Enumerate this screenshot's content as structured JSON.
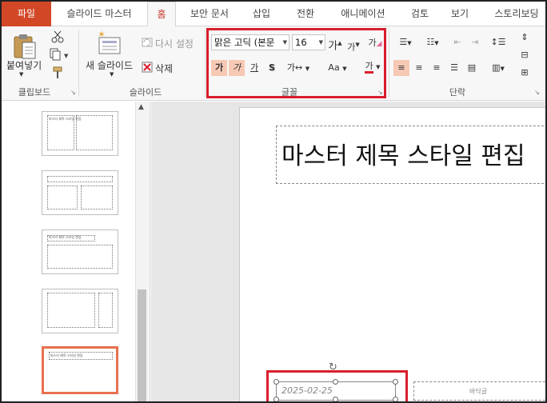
{
  "tabs": [
    "파일",
    "슬라이드 마스터",
    "홈",
    "보안 문서",
    "삽입",
    "전환",
    "애니메이션",
    "검토",
    "보기",
    "스토리보딩"
  ],
  "clipboard": {
    "paste_label": "붙여넣기",
    "group_label": "클립보드"
  },
  "slides_group": {
    "new_slide_label": "새 슬라이드",
    "reset_label": "다시 설정",
    "delete_label": "삭제",
    "group_label": "슬라이드"
  },
  "font_group": {
    "font_name": "맑은 고딕 (본문",
    "font_size": "16",
    "grow_label": "가",
    "shrink_label": "가",
    "clear_label": "가",
    "bold_label": "가",
    "italic_label": "가",
    "underline_label": "가",
    "shadow_label": "S",
    "spacing_label": "가↔",
    "case_label": "Aa",
    "color_label": "가",
    "group_label": "글꼴"
  },
  "paragraph_group": {
    "group_label": "단락"
  },
  "slide": {
    "title": "마스터 제목 스타일 편집",
    "date": "2025-02-25",
    "footer": "바닥글"
  },
  "thumbnails": [
    {
      "caption": "마스터 제목 스타일 편집"
    },
    {
      "caption": ""
    },
    {
      "caption": "마스터 제목 스타일 편집"
    },
    {
      "caption": ""
    },
    {
      "caption": "마스터 제목 스타일 편집"
    }
  ],
  "colors": {
    "file_tab": "#d24726",
    "active_tab_text": "#c4372c",
    "highlight": "#d81e2c",
    "selected_thumb": "#e8704f"
  }
}
